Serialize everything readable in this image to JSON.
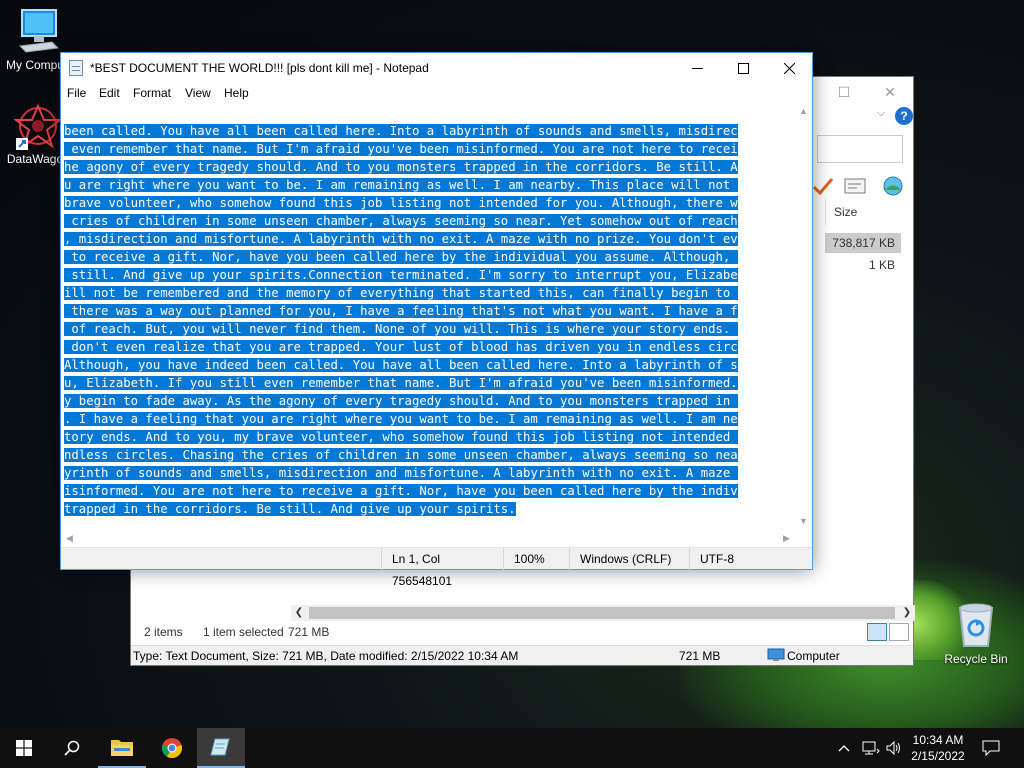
{
  "desktop": {
    "icons": [
      {
        "label": "My Compu"
      },
      {
        "label": "DataWago"
      },
      {
        "label": "Recycle Bin"
      }
    ]
  },
  "explorer": {
    "size_header": "Size",
    "rows": [
      {
        "size": "738,817 KB",
        "selected": true
      },
      {
        "size": "1 KB",
        "selected": false
      }
    ],
    "status": {
      "items_count": "2 items",
      "selected": "1 item selected",
      "selected_size": "721 MB"
    },
    "details": {
      "info": "Type: Text Document, Size: 721 MB, Date modified: 2/15/2022 10:34 AM",
      "size": "721 MB",
      "location": "Computer"
    }
  },
  "notepad": {
    "title": "*BEST DOCUMENT THE WORLD!!! [pls dont kill me] - Notepad",
    "menu": [
      "File",
      "Edit",
      "Format",
      "View",
      "Help"
    ],
    "lines": [
      "been called. You have all been called here. Into a labyrinth of sounds and smells, misdirec",
      " even remember that name. But I'm afraid you've been misinformed. You are not here to recei",
      "he agony of every tragedy should. And to you monsters trapped in the corridors. Be still. A",
      "u are right where you want to be. I am remaining as well. I am nearby. This place will not ",
      "brave volunteer, who somehow found this job listing not intended for you. Although, there w",
      " cries of children in some unseen chamber, always seeming so near. Yet somehow out of reach",
      ", misdirection and misfortune. A labyrinth with no exit. A maze with no prize. You don't ev",
      " to receive a gift. Nor, have you been called here by the individual you assume. Although, ",
      " still. And give up your spirits.Connection terminated. I'm sorry to interrupt you, Elizabe",
      "ill not be remembered and the memory of everything that started this, can finally begin to ",
      " there was a way out planned for you, I have a feeling that's not what you want. I have a f",
      " of reach. But, you will never find them. None of you will. This is where your story ends. ",
      " don't even realize that you are trapped. Your lust of blood has driven you in endless circ",
      "Although, you have indeed been called. You have all been called here. Into a labyrinth of s",
      "u, Elizabeth. If you still even remember that name. But I'm afraid you've been misinformed.",
      "y begin to fade away. As the agony of every tragedy should. And to you monsters trapped in ",
      ". I have a feeling that you are right where you want to be. I am remaining as well. I am ne",
      "tory ends. And to you, my brave volunteer, who somehow found this job listing not intended ",
      "ndless circles. Chasing the cries of children in some unseen chamber, always seeming so nea",
      "yrinth of sounds and smells, misdirection and misfortune. A labyrinth with no exit. A maze ",
      "isinformed. You are not here to receive a gift. Nor, have you been called here by the indiv",
      "trapped in the corridors. Be still. And give up your spirits."
    ],
    "status": {
      "position": "Ln 1, Col 756548101",
      "zoom": "100%",
      "line_ending": "Windows (CRLF)",
      "encoding": "UTF-8"
    }
  },
  "taskbar": {
    "time": "10:34 AM",
    "date": "2/15/2022"
  },
  "colors": {
    "selection": "#0078d7",
    "accent": "#5b9bd5"
  }
}
